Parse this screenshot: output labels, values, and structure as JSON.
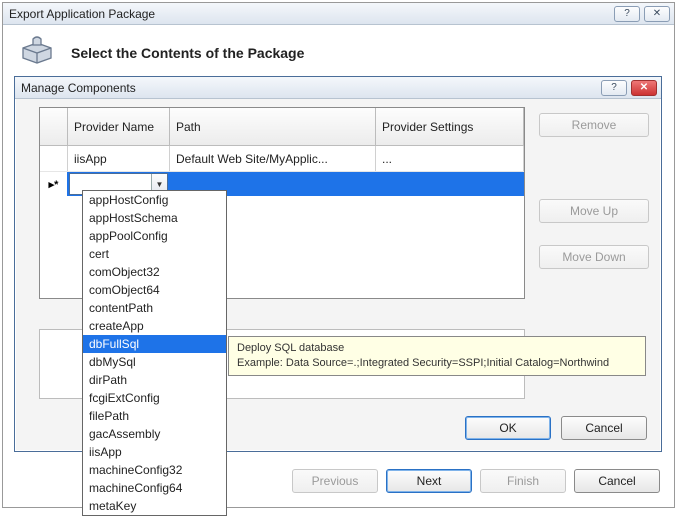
{
  "outer": {
    "title": "Export Application Package",
    "heading": "Select the Contents of the Package",
    "buttons": {
      "previous": "Previous",
      "next": "Next",
      "finish": "Finish",
      "cancel": "Cancel"
    }
  },
  "inner": {
    "title": "Manage Components",
    "grid": {
      "headers": {
        "provider": "Provider Name",
        "path": "Path",
        "settings": "Provider Settings"
      },
      "row1": {
        "provider": "iisApp",
        "path": "Default Web Site/MyApplic...",
        "settings": "..."
      },
      "newrow_indicator": "▸*"
    },
    "buttons": {
      "remove": "Remove",
      "moveup": "Move Up",
      "movedown": "Move Down",
      "ok": "OK",
      "cancel": "Cancel"
    }
  },
  "dropdown": {
    "items": [
      "appHostConfig",
      "appHostSchema",
      "appPoolConfig",
      "cert",
      "comObject32",
      "comObject64",
      "contentPath",
      "createApp",
      "dbFullSql",
      "dbMySql",
      "dirPath",
      "fcgiExtConfig",
      "filePath",
      "gacAssembly",
      "iisApp",
      "machineConfig32",
      "machineConfig64",
      "metaKey"
    ],
    "selected_index": 8
  },
  "tooltip": {
    "line1": "Deploy SQL database",
    "line2": "Example: Data Source=.;Integrated Security=SSPI;Initial Catalog=Northwind"
  }
}
